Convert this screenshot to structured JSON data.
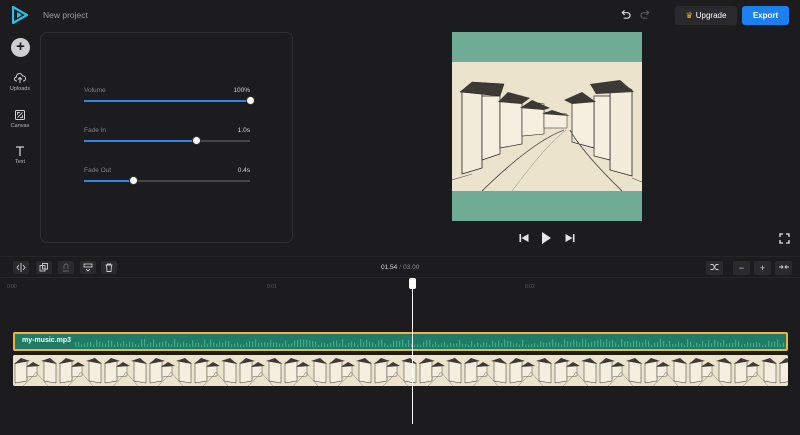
{
  "header": {
    "project_name": "New project",
    "upgrade_label": "Upgrade",
    "export_label": "Export"
  },
  "sidebar": {
    "items": [
      {
        "label": "Uploads",
        "icon": "upload-icon"
      },
      {
        "label": "Canvas",
        "icon": "canvas-icon"
      },
      {
        "label": "Text",
        "icon": "text-icon"
      }
    ]
  },
  "settings": {
    "volume": {
      "label": "Volume",
      "value": "100%",
      "level": 1.0
    },
    "fade_in": {
      "label": "Fade In",
      "value": "1.0s",
      "level": 0.68
    },
    "fade_out": {
      "label": "Fade Out",
      "value": "0.4s",
      "level": 0.3
    }
  },
  "playback": {
    "current_time": "01.54",
    "separator": "/",
    "total_time": "03.00"
  },
  "timeline": {
    "ruler": [
      "0:00",
      "0:01",
      "0:02"
    ],
    "audio_clip": "my-music.mp3",
    "playhead_position": 0.51
  },
  "colors": {
    "accent": "#1c7ff2",
    "audio_track": "#1f7a66",
    "audio_border": "#e9b53a",
    "preview_bg": "#6fab95"
  }
}
